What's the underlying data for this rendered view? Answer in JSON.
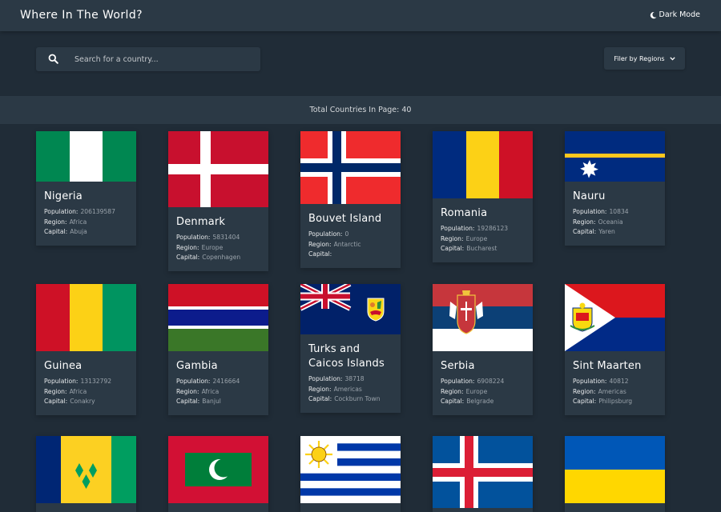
{
  "header": {
    "title": "Where In The World?",
    "mode_label": "Dark Mode"
  },
  "search": {
    "placeholder": "Search for a country..."
  },
  "filter": {
    "label": "Filer by Regions"
  },
  "summary": {
    "text": "Total Countries In Page: 40"
  },
  "labels": {
    "population": "Population:",
    "region": "Region:",
    "capital": "Capital:"
  },
  "countries": [
    {
      "name": "Nigeria",
      "population": "206139587",
      "region": "Africa",
      "capital": "Abuja"
    },
    {
      "name": "Denmark",
      "population": "5831404",
      "region": "Europe",
      "capital": "Copenhagen"
    },
    {
      "name": "Bouvet Island",
      "population": "0",
      "region": "Antarctic",
      "capital": ""
    },
    {
      "name": "Romania",
      "population": "19286123",
      "region": "Europe",
      "capital": "Bucharest"
    },
    {
      "name": "Nauru",
      "population": "10834",
      "region": "Oceania",
      "capital": "Yaren"
    },
    {
      "name": "Guinea",
      "population": "13132792",
      "region": "Africa",
      "capital": "Conakry"
    },
    {
      "name": "Gambia",
      "population": "2416664",
      "region": "Africa",
      "capital": "Banjul"
    },
    {
      "name": "Turks and Caicos Islands",
      "population": "38718",
      "region": "Americas",
      "capital": "Cockburn Town"
    },
    {
      "name": "Serbia",
      "population": "6908224",
      "region": "Europe",
      "capital": "Belgrade"
    },
    {
      "name": "Sint Maarten",
      "population": "40812",
      "region": "Americas",
      "capital": "Philipsburg"
    }
  ]
}
